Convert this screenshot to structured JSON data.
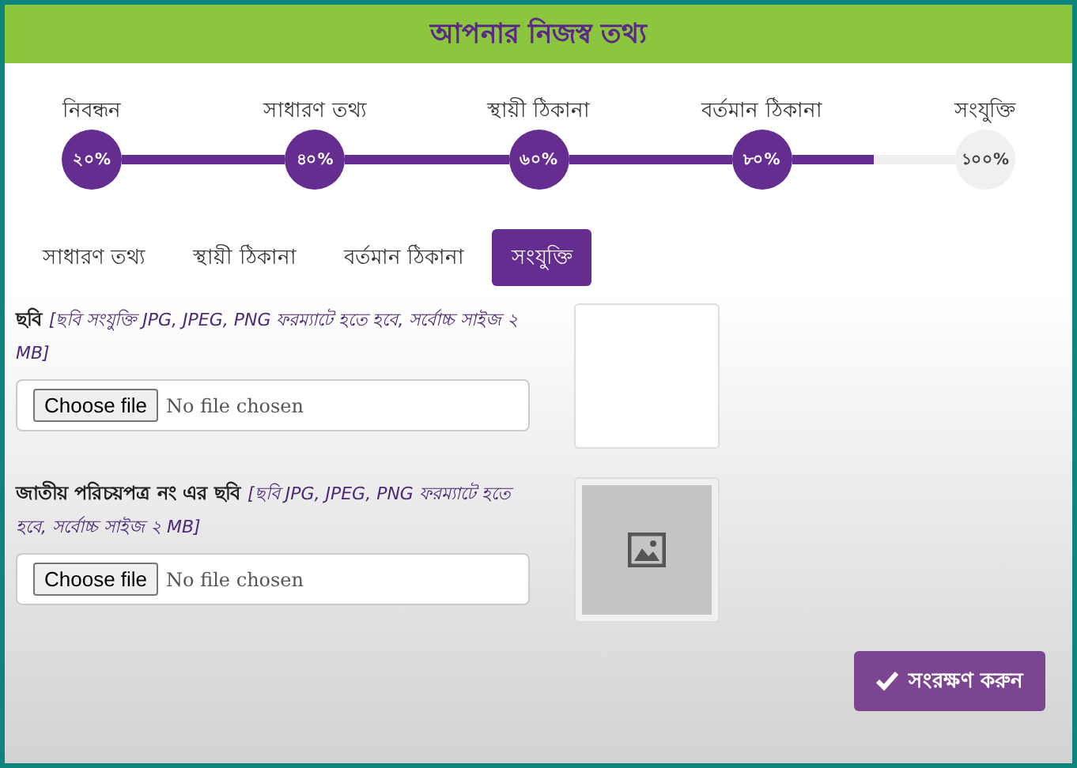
{
  "header": {
    "title": "আপনার নিজস্ব তথ্য"
  },
  "stepper": {
    "steps": [
      {
        "label": "নিবন্ধন",
        "percent": "২০%",
        "done": true
      },
      {
        "label": "সাধারণ তথ্য",
        "percent": "৪০%",
        "done": true
      },
      {
        "label": "স্থায়ী ঠিকানা",
        "percent": "৬০%",
        "done": true
      },
      {
        "label": "বর্তমান ঠিকানা",
        "percent": "৮০%",
        "done": true
      },
      {
        "label": "সংযুক্তি",
        "percent": "১০০%",
        "done": false
      }
    ]
  },
  "tabs": [
    {
      "label": "সাধারণ তথ্য",
      "selected": false
    },
    {
      "label": "স্থায়ী ঠিকানা",
      "selected": false
    },
    {
      "label": "বর্তমান ঠিকানা",
      "selected": false
    },
    {
      "label": "সংযুক্তি",
      "selected": true
    }
  ],
  "uploads": [
    {
      "label": "ছবি",
      "hint": "[ছবি সংযুক্তি JPG, JPEG, PNG ফরম্যাটে হতে হবে, সর্বোচ্চ সাইজ ২ MB]",
      "button": "Choose file",
      "status": "No file chosen",
      "kind": "empty"
    },
    {
      "label": "জাতীয় পরিচয়পত্র নং এর ছবি",
      "hint": "[ছবি JPG, JPEG, PNG ফরম্যাটে হতে হবে, সর্বোচ্চ সাইজ ২ MB]",
      "button": "Choose file",
      "status": "No file chosen",
      "kind": "placeholder"
    }
  ],
  "save_button": "সংরক্ষণ করুন"
}
